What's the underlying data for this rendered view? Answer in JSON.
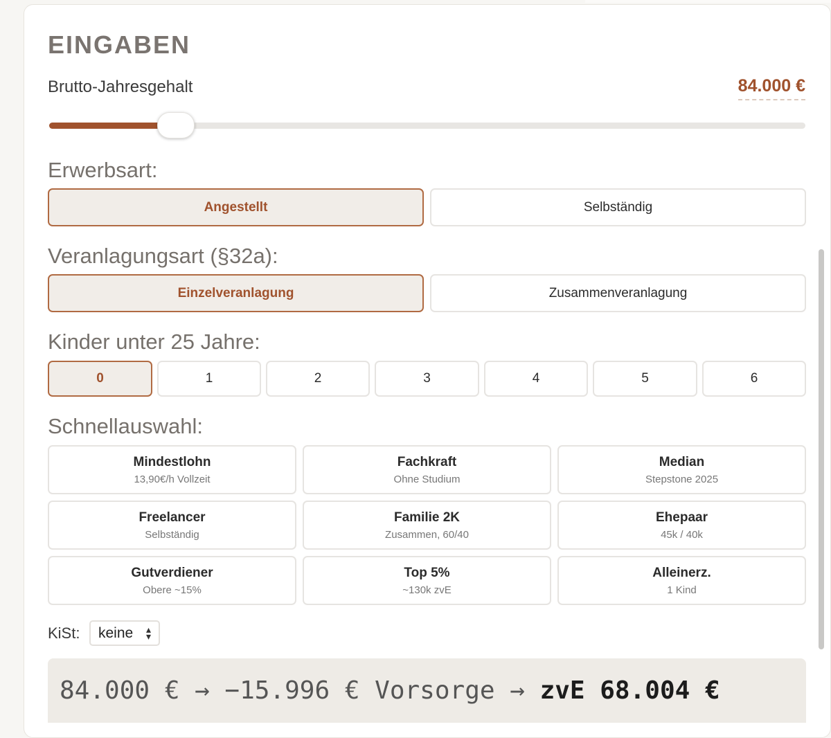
{
  "header": {
    "title": "EINGABEN"
  },
  "salary": {
    "label": "Brutto-Jahresgehalt",
    "value": "84.000 €",
    "slider_fraction": 0.167
  },
  "erwerbsart": {
    "label": "Erwerbsart:",
    "options": [
      "Angestellt",
      "Selbständig"
    ],
    "selected": "Angestellt"
  },
  "veranlagung": {
    "label": "Veranlagungsart (§32a):",
    "options": [
      "Einzelveranlagung",
      "Zusammenveranlagung"
    ],
    "selected": "Einzelveranlagung"
  },
  "kinder": {
    "label": "Kinder unter 25 Jahre:",
    "options": [
      "0",
      "1",
      "2",
      "3",
      "4",
      "5",
      "6"
    ],
    "selected": "0"
  },
  "schnellauswahl": {
    "label": "Schnellauswahl:",
    "presets": [
      {
        "title": "Mindestlohn",
        "sub": "13,90€/h Vollzeit"
      },
      {
        "title": "Fachkraft",
        "sub": "Ohne Studium"
      },
      {
        "title": "Median",
        "sub": "Stepstone 2025"
      },
      {
        "title": "Freelancer",
        "sub": "Selbständig"
      },
      {
        "title": "Familie 2K",
        "sub": "Zusammen, 60/40"
      },
      {
        "title": "Ehepaar",
        "sub": "45k / 40k"
      },
      {
        "title": "Gutverdiener",
        "sub": "Obere ~15%"
      },
      {
        "title": "Top 5%",
        "sub": "~130k zvE"
      },
      {
        "title": "Alleinerz.",
        "sub": "1 Kind"
      }
    ]
  },
  "kist": {
    "label": "KiSt:",
    "selected": "keine"
  },
  "summary": {
    "prefix": "84.000 € → −15.996 € Vorsorge → ",
    "result": "zvE 68.004 €"
  },
  "colors": {
    "accent": "#a0522d",
    "active_bg": "#f1ede8",
    "summary_bg": "#eeebe6"
  }
}
